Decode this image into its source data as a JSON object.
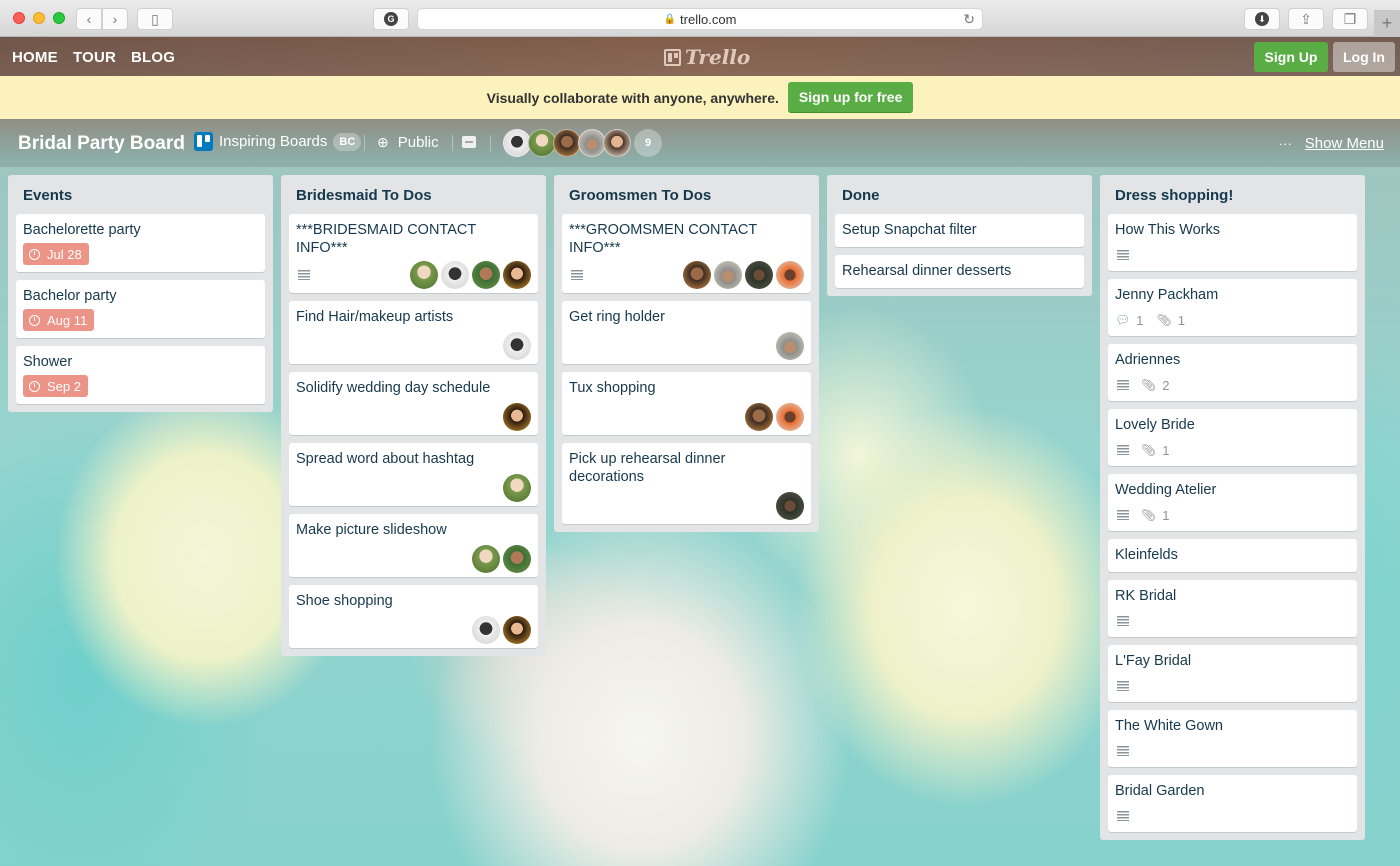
{
  "browser": {
    "url": "trello.com",
    "buttons": {
      "back": "‹",
      "forward": "›",
      "sidebar": "▯",
      "extension": "G",
      "reload": "↻",
      "downloads": "⬇",
      "share": "⇪",
      "tabs": "❐",
      "new_tab": "+"
    }
  },
  "topnav": {
    "links": [
      "HOME",
      "TOUR",
      "BLOG"
    ],
    "logo": "Trello",
    "sign_up": "Sign Up",
    "log_in": "Log In"
  },
  "banner": {
    "message": "Visually collaborate with anyone, anywhere.",
    "cta": "Sign up for free"
  },
  "board": {
    "title": "Bridal Party Board",
    "team": "Inspiring Boards",
    "team_badge": "BC",
    "visibility": "Public",
    "members_more": "9",
    "show_menu_dots": "···",
    "show_menu": "Show Menu"
  },
  "colors": {
    "green": "#5aac44",
    "due_label": "#ec9488",
    "banner": "#fbf2bd",
    "list_bg": "#e2e4e6",
    "team_blue": "#0079bf"
  },
  "lists": [
    {
      "title": "Events",
      "cards": [
        {
          "title": "Bachelorette party",
          "due": "Jul 28"
        },
        {
          "title": "Bachelor party",
          "due": "Aug 11"
        },
        {
          "title": "Shower",
          "due": "Sep 2"
        }
      ]
    },
    {
      "title": "Bridesmaid To Dos",
      "cards": [
        {
          "title": "***BRIDESMAID CONTACT INFO***",
          "description": true,
          "members": 4
        },
        {
          "title": "Find Hair/makeup artists",
          "members": 1
        },
        {
          "title": "Solidify wedding day schedule",
          "members": 1
        },
        {
          "title": "Spread word about hashtag",
          "members": 1
        },
        {
          "title": "Make picture slideshow",
          "members": 2
        },
        {
          "title": "Shoe shopping",
          "members": 2
        }
      ]
    },
    {
      "title": "Groomsmen To Dos",
      "cards": [
        {
          "title": "***GROOMSMEN CONTACT INFO***",
          "description": true,
          "members": 4
        },
        {
          "title": "Get ring holder",
          "members": 1
        },
        {
          "title": "Tux shopping",
          "members": 2
        },
        {
          "title": "Pick up rehearsal dinner decorations",
          "members": 1
        }
      ]
    },
    {
      "title": "Done",
      "cards": [
        {
          "title": "Setup Snapchat filter"
        },
        {
          "title": "Rehearsal dinner desserts"
        }
      ]
    },
    {
      "title": "Dress shopping!",
      "cards": [
        {
          "title": "How This Works",
          "description": true
        },
        {
          "title": "Jenny Packham",
          "comments": "1",
          "attachments": "1"
        },
        {
          "title": "Adriennes",
          "description": true,
          "attachments": "2"
        },
        {
          "title": "Lovely Bride",
          "description": true,
          "attachments": "1"
        },
        {
          "title": "Wedding Atelier",
          "description": true,
          "attachments": "1"
        },
        {
          "title": "Kleinfelds"
        },
        {
          "title": "RK Bridal",
          "description": true
        },
        {
          "title": "L'Fay Bridal",
          "description": true
        },
        {
          "title": "The White Gown",
          "description": true
        },
        {
          "title": "Bridal Garden",
          "description": true
        }
      ]
    }
  ]
}
